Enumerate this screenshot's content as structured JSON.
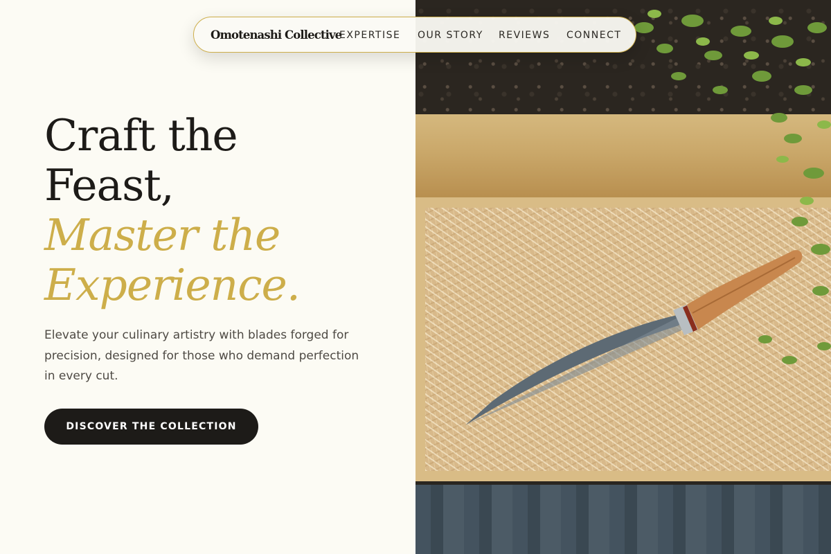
{
  "nav": {
    "brand": "Omotenashi Collective",
    "links": [
      {
        "label": "EXPERTISE"
      },
      {
        "label": "OUR STORY"
      },
      {
        "label": "REVIEWS"
      },
      {
        "label": "CONNECT"
      }
    ]
  },
  "hero": {
    "headline_line1": "Craft the",
    "headline_line2": "Feast,",
    "accent_line1": "Master the",
    "accent_line2": "Experience.",
    "lede": "Elevate your culinary artistry with blades forged for precision, designed for those who demand perfection in every cut.",
    "cta_label": "DISCOVER THE COLLECTION"
  },
  "colors": {
    "background": "#fcfbf4",
    "ink": "#1d1b18",
    "accent_gold": "#cdae4a",
    "body_text": "#4e4a44"
  },
  "image": {
    "subject": "kitchen-knife-in-straw-filled-wooden-crate-with-herbs"
  }
}
